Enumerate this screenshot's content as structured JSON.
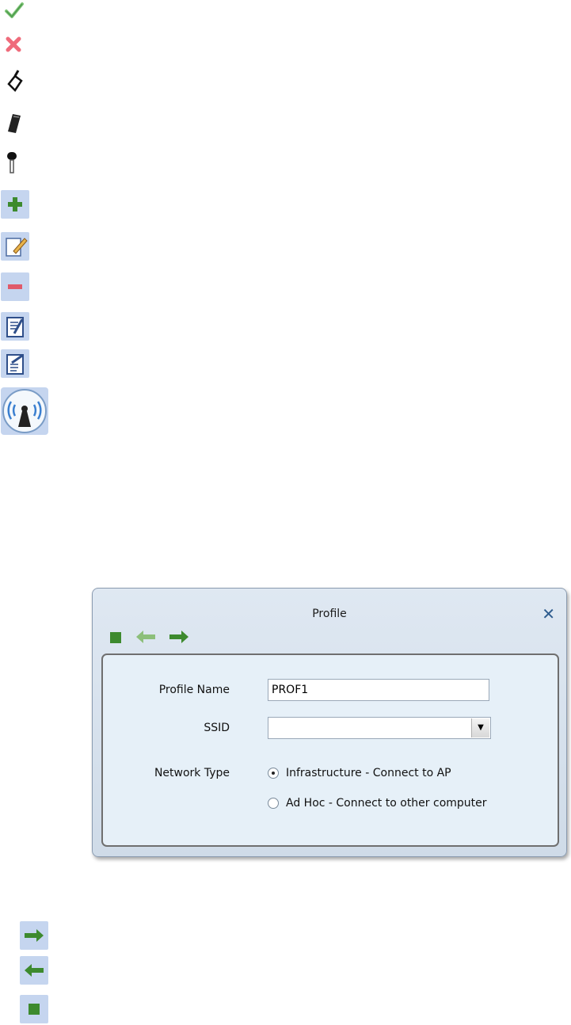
{
  "legend_icons": [
    {
      "name": "check-icon"
    },
    {
      "name": "x-icon"
    },
    {
      "name": "antenna-wand-icon"
    },
    {
      "name": "card-adapter-icon"
    },
    {
      "name": "key-icon"
    },
    {
      "name": "add-icon"
    },
    {
      "name": "edit-icon"
    },
    {
      "name": "remove-icon"
    },
    {
      "name": "import-icon"
    },
    {
      "name": "export-icon"
    },
    {
      "name": "wireless-signal-icon"
    }
  ],
  "dialog": {
    "title": "Profile",
    "close_icon": "close-icon",
    "toolbar": [
      "stop-icon",
      "back-arrow-icon",
      "forward-arrow-icon"
    ],
    "fields": {
      "profile_name_label": "Profile Name",
      "profile_name_value": "PROF1",
      "ssid_label": "SSID",
      "ssid_value": "",
      "network_type_label": "Network Type",
      "network_type_options": [
        {
          "label": "Infrastructure - Connect to AP",
          "selected": true
        },
        {
          "label": "Ad Hoc - Connect to other computer",
          "selected": false
        }
      ]
    }
  },
  "bottom_icons": [
    "forward-arrow-icon",
    "back-arrow-icon",
    "stop-icon"
  ],
  "colors": {
    "green": "#3d8a2e",
    "green_light": "#8cbf7a",
    "icon_bg": "#c5d5ef",
    "red": "#e05a6a",
    "close": "#2e5c8e"
  }
}
